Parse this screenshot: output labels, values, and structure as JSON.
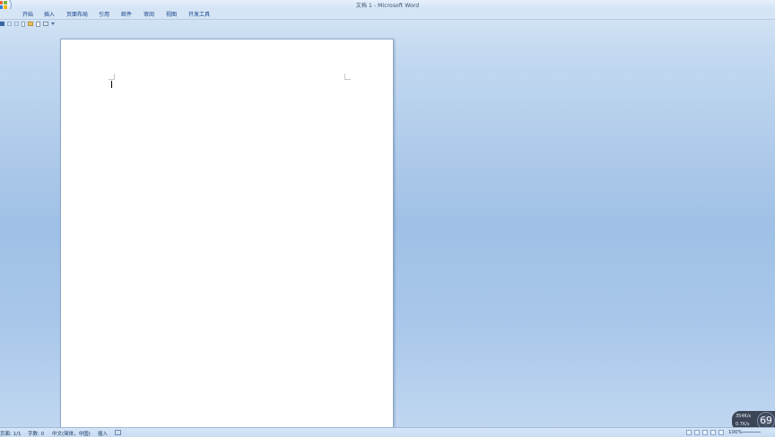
{
  "window": {
    "title": "文档 1 - Microsoft Word"
  },
  "ribbon": {
    "tabs": [
      "开始",
      "插入",
      "页面布局",
      "引用",
      "邮件",
      "审阅",
      "视图",
      "开发工具"
    ]
  },
  "quick_access": {
    "icons": [
      "save-icon",
      "undo-icon",
      "redo-icon",
      "new-document-icon",
      "open-folder-icon",
      "print-preview-icon",
      "print-icon",
      "customize-dropdown-icon"
    ]
  },
  "statusbar": {
    "page": "页面: 1/1",
    "words": "字数: 0",
    "language": "中文(简体，中国)",
    "mode": "插入",
    "zoom": "100%"
  },
  "widget": {
    "upload": "354K/s",
    "download": "0.7K/s",
    "percent": "69"
  }
}
